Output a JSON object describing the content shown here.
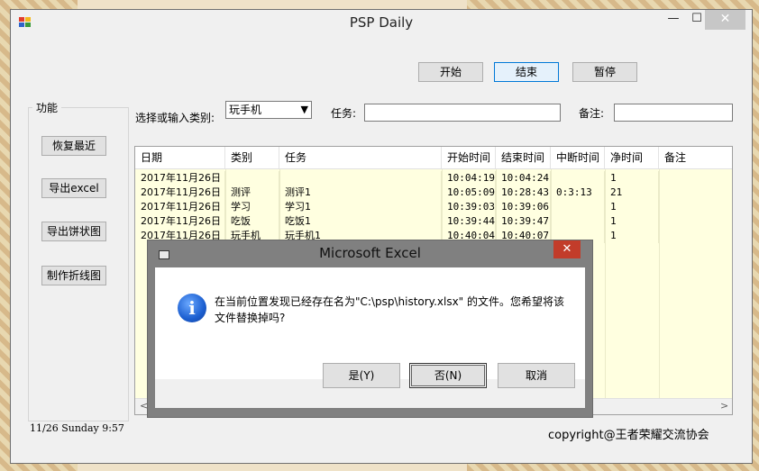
{
  "window": {
    "title": "PSP Daily",
    "minimize": "—",
    "maximize": "☐",
    "close": "✕"
  },
  "toolbar": {
    "start_label": "开始",
    "end_label": "结束",
    "pause_label": "暂停"
  },
  "function_group": {
    "label": "功能",
    "buttons": [
      "恢复最近",
      "导出excel",
      "导出饼状图",
      "制作折线图"
    ]
  },
  "filter": {
    "category_label": "选择或输入类别:",
    "category_value": "玩手机",
    "task_label": "任务:",
    "task_value": "",
    "note_label": "备注:",
    "note_value": ""
  },
  "table": {
    "columns": [
      "日期",
      "类别",
      "任务",
      "开始时间",
      "结束时间",
      "中断时间",
      "净时间",
      "备注"
    ],
    "rows": [
      [
        "2017年11月26日",
        "",
        "",
        "10:04:19",
        "10:04:24",
        "",
        "1",
        ""
      ],
      [
        "2017年11月26日",
        "测评",
        "测评1",
        "10:05:09",
        "10:28:43",
        "0:3:13",
        "21",
        ""
      ],
      [
        "2017年11月26日",
        "学习",
        "学习1",
        "10:39:03",
        "10:39:06",
        "",
        "1",
        ""
      ],
      [
        "2017年11月26日",
        "吃饭",
        "吃饭1",
        "10:39:44",
        "10:39:47",
        "",
        "1",
        ""
      ],
      [
        "2017年11月26日",
        "玩手机",
        "玩手机1",
        "10:40:04",
        "10:40:07",
        "",
        "1",
        ""
      ]
    ],
    "scroll_left": "<",
    "scroll_right": ">"
  },
  "status": "11/26  Sunday 9:57",
  "copyright": "copyright@王者荣耀交流协会",
  "dialog": {
    "title": "Microsoft Excel",
    "close": "✕",
    "icon": "i",
    "message": "在当前位置发现已经存在名为\"C:\\psp\\history.xlsx\" 的文件。您希望将该文件替换掉吗?",
    "yes": "是(Y)",
    "no": "否(N)",
    "cancel": "取消"
  }
}
